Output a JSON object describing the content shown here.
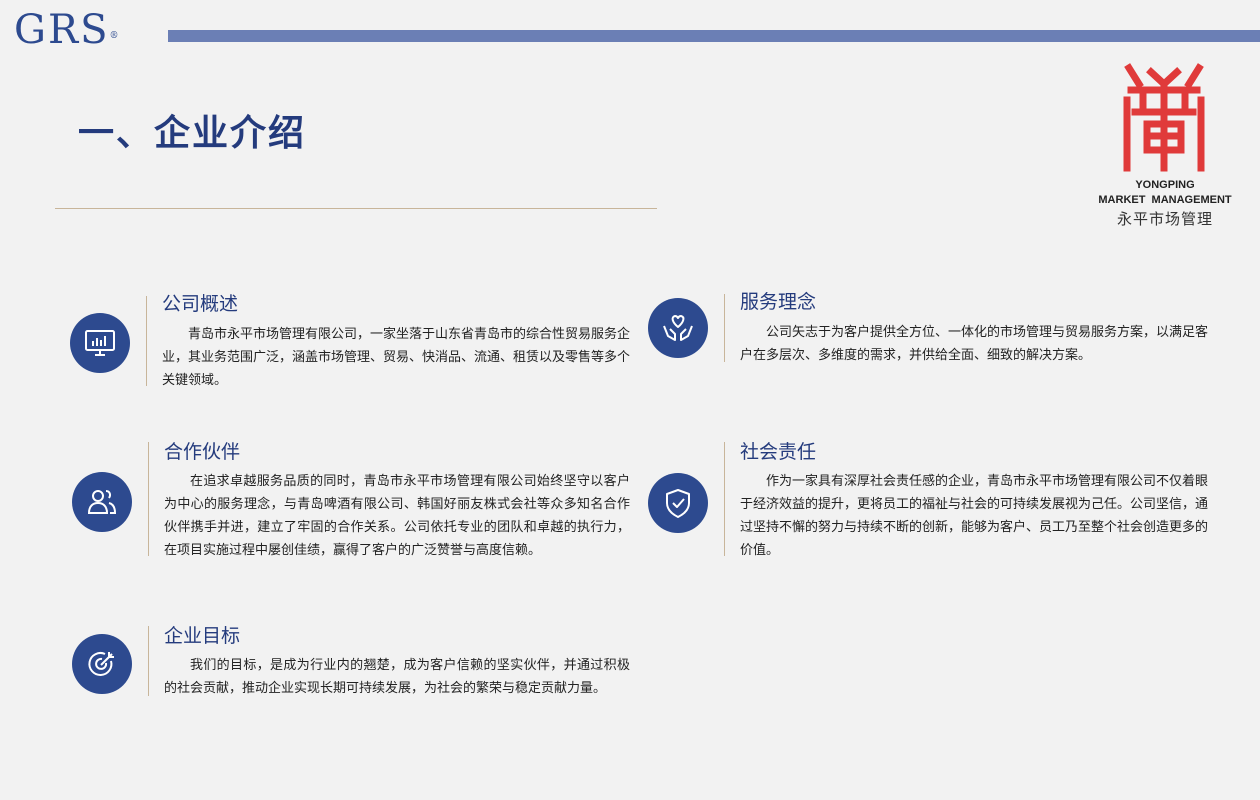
{
  "header": {
    "grs_logo_text": "GRS",
    "grs_logo_mark": "®",
    "title": "一、企业介绍"
  },
  "brand": {
    "line1": "YONGPING",
    "line2": "MARKET  MANAGEMENT",
    "chinese_name": "永平市场管理",
    "color": "#e03a3a"
  },
  "colors": {
    "accent": "#2d4a8f",
    "title": "#243b7d",
    "rule": "#c8b59a",
    "top_bar": "#6b7fb5"
  },
  "sections": [
    {
      "icon": "monitor-chart-icon",
      "title": "公司概述",
      "body": "青岛市永平市场管理有限公司，一家坐落于山东省青岛市的综合性贸易服务企业，其业务范围广泛，涵盖市场管理、贸易、快消品、流通、租赁以及零售等多个关键领域。"
    },
    {
      "icon": "hands-heart-icon",
      "title": "服务理念",
      "body": "公司矢志于为客户提供全方位、一体化的市场管理与贸易服务方案，以满足客户在多层次、多维度的需求，并供给全面、细致的解决方案。"
    },
    {
      "icon": "users-icon",
      "title": "合作伙伴",
      "body": "在追求卓越服务品质的同时，青岛市永平市场管理有限公司始终坚守以客户为中心的服务理念，与青岛啤酒有限公司、韩国好丽友株式会社等众多知名合作伙伴携手并进，建立了牢固的合作关系。公司依托专业的团队和卓越的执行力，在项目实施过程中屡创佳绩，赢得了客户的广泛赞誉与高度信赖。"
    },
    {
      "icon": "shield-check-icon",
      "title": "社会责任",
      "body": "作为一家具有深厚社会责任感的企业，青岛市永平市场管理有限公司不仅着眼于经济效益的提升，更将员工的福祉与社会的可持续发展视为己任。公司坚信，通过坚持不懈的努力与持续不断的创新，能够为客户、员工乃至整个社会创造更多的价值。"
    },
    {
      "icon": "target-icon",
      "title": "企业目标",
      "body": "我们的目标，是成为行业内的翘楚，成为客户信赖的坚实伙伴，并通过积极的社会贡献，推动企业实现长期可持续发展，为社会的繁荣与稳定贡献力量。"
    }
  ]
}
